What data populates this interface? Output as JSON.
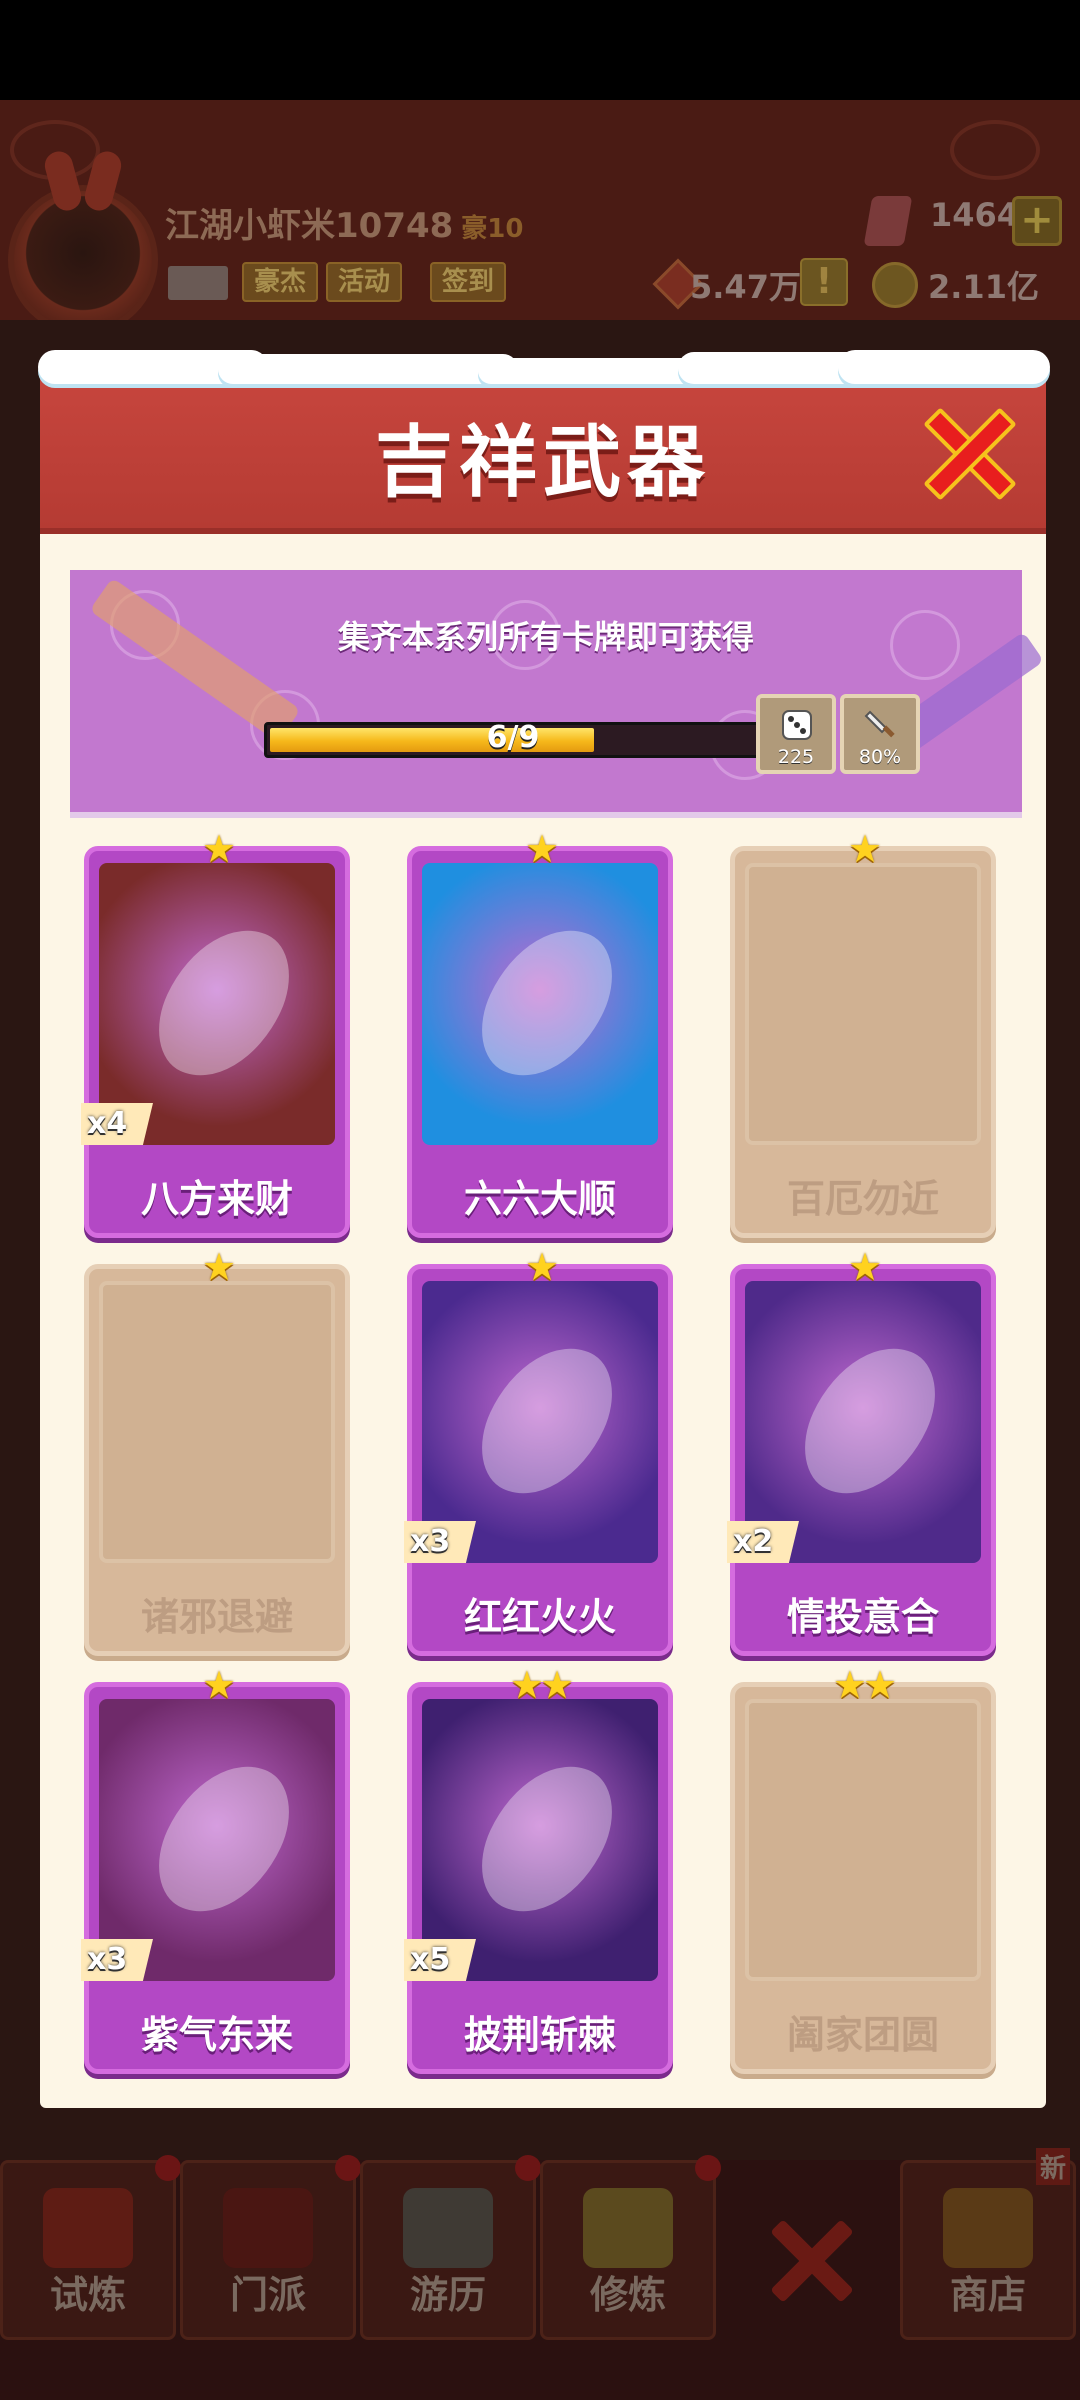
{
  "player": {
    "name": "江湖小虾米10748",
    "rank": "豪10",
    "buttons": [
      "豪杰",
      "活动",
      "签到"
    ],
    "gems": "1464",
    "silver": "5.47万",
    "gold": "2.11亿"
  },
  "dialog": {
    "title": "吉祥武器",
    "subtitle": "集齐本系列所有卡牌即可获得",
    "progress_text": "6/9",
    "progress_fraction": 0.667,
    "rewards": [
      {
        "icon": "dice-icon",
        "value": "225"
      },
      {
        "icon": "sword-icon",
        "value": "80%"
      }
    ],
    "cards": [
      {
        "name": "八方来财",
        "stars": "★",
        "count": "x4",
        "owned": true,
        "art_color": "#7a2b2a"
      },
      {
        "name": "六六大顺",
        "stars": "★",
        "count": "",
        "owned": true,
        "art_color": "#1f8fe0"
      },
      {
        "name": "百厄勿近",
        "stars": "★",
        "count": "",
        "owned": false,
        "art_color": ""
      },
      {
        "name": "诸邪退避",
        "stars": "★",
        "count": "",
        "owned": false,
        "art_color": ""
      },
      {
        "name": "红红火火",
        "stars": "★",
        "count": "x3",
        "owned": true,
        "art_color": "#4b2a8f"
      },
      {
        "name": "情投意合",
        "stars": "★",
        "count": "x2",
        "owned": true,
        "art_color": "#4f2a8a"
      },
      {
        "name": "紫气东来",
        "stars": "★",
        "count": "x3",
        "owned": true,
        "art_color": "#6f2a6a"
      },
      {
        "name": "披荆斩棘",
        "stars": "★★",
        "count": "x5",
        "owned": true,
        "art_color": "#3f2070"
      },
      {
        "name": "阖家团圆",
        "stars": "★★",
        "count": "",
        "owned": false,
        "art_color": ""
      }
    ]
  },
  "nav": {
    "tabs": [
      "试炼",
      "门派",
      "游历",
      "修炼",
      "商店"
    ],
    "new_tag": "新"
  },
  "colors": {
    "accent_red": "#c8463e",
    "card_purple": "#b348c5",
    "card_locked": "#d7b89a",
    "star": "#ffd21f"
  }
}
